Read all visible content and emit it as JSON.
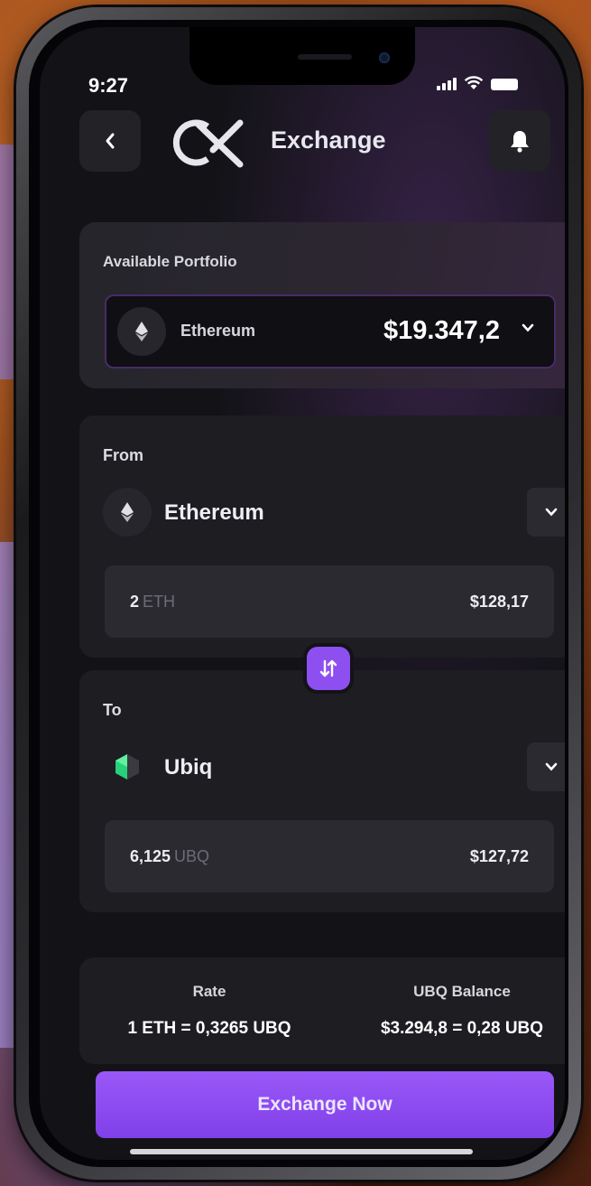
{
  "status_bar": {
    "time": "9:27"
  },
  "header": {
    "title": "Exchange"
  },
  "portfolio": {
    "label": "Available Portfolio",
    "asset": "Ethereum",
    "value": "$19.347,2"
  },
  "from": {
    "label": "From",
    "coin": "Ethereum",
    "amount": "2",
    "unit": "ETH",
    "usd": "$128,17"
  },
  "to": {
    "label": "To",
    "coin": "Ubiq",
    "amount": "6,125",
    "unit": "UBQ",
    "usd": "$127,72"
  },
  "rate": {
    "label": "Rate",
    "value": "1 ETH = 0,3265 UBQ"
  },
  "balance": {
    "label": "UBQ Balance",
    "value": "$3.294,8 = 0,28 UBQ"
  },
  "cta": {
    "label": "Exchange Now"
  },
  "colors": {
    "accent": "#8e4ff0",
    "screen_bg": "#131317",
    "card_bg": "#1d1d22"
  },
  "icons": [
    "back-chevron-icon",
    "brand-logo-icon",
    "bell-icon",
    "ethereum-icon",
    "ubiq-icon",
    "chevron-down-icon",
    "swap-arrows-icon",
    "signal-icon",
    "wifi-icon",
    "battery-icon"
  ]
}
